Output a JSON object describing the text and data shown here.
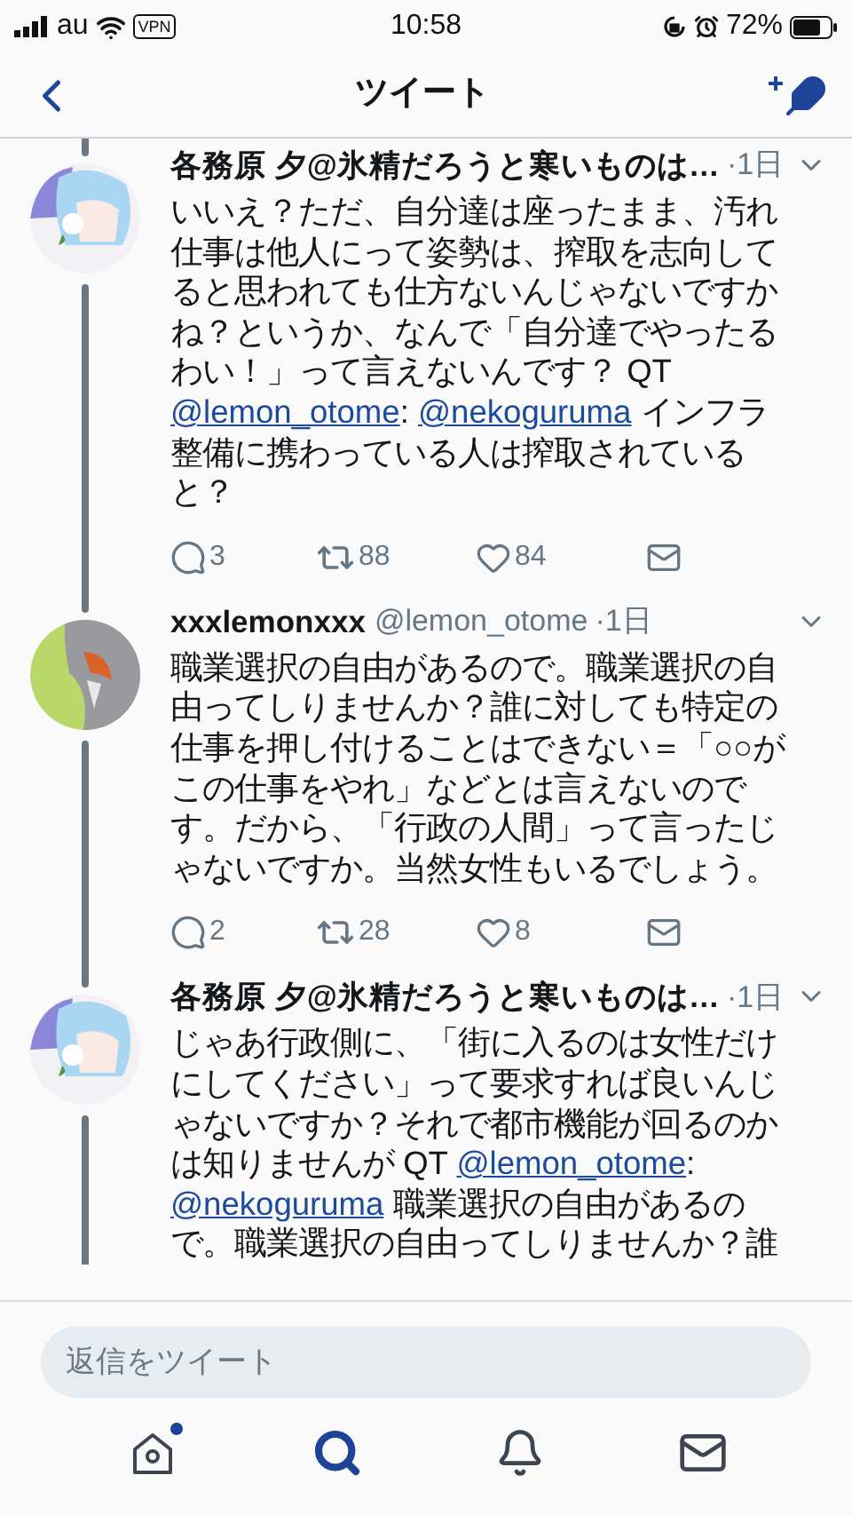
{
  "status_bar": {
    "carrier": "au",
    "vpn": "VPN",
    "time": "10:58",
    "battery": "72%"
  },
  "header": {
    "title": "ツイート"
  },
  "tweets": [
    {
      "name": "各務原 夕@氷精だろうと寒いものは…",
      "time": "·1日",
      "body": [
        {
          "kind": "text",
          "text": "いいえ？ただ、自分達は座ったまま、汚れ仕事は他人にって姿勢は、搾取を志向してると思われても仕方ないんじゃないですかね？というか、なんで「自分達でやったるわい！」って言えないんです？ QT "
        },
        {
          "kind": "mention",
          "text": "@lemon_otome"
        },
        {
          "kind": "text",
          "text": ": "
        },
        {
          "kind": "mention",
          "text": "@nekoguruma"
        },
        {
          "kind": "text",
          "text": " インフラ整備に携わっている人は搾取されていると？"
        }
      ],
      "replies": "3",
      "retweets": "88",
      "likes": "84"
    },
    {
      "name": "xxxlemonxxx",
      "handle": "@lemon_otome",
      "time": "·1日",
      "body": [
        {
          "kind": "text",
          "text": "職業選択の自由があるので。職業選択の自由ってしりませんか？誰に対しても特定の仕事を押し付けることはできない＝「○○がこの仕事をやれ」などとは言えないのです。だから、「行政の人間」って言ったじゃないですか。当然女性もいるでしょう。"
        }
      ],
      "replies": "2",
      "retweets": "28",
      "likes": "8"
    },
    {
      "name": "各務原 夕@氷精だろうと寒いものは…",
      "time": "·1日",
      "body": [
        {
          "kind": "text",
          "text": "じゃあ行政側に、「街に入るのは女性だけにしてください」って要求すれば良いんじゃないですか？それで都市機能が回るのかは知りませんが QT "
        },
        {
          "kind": "mention",
          "text": "@lemon_otome"
        },
        {
          "kind": "text",
          "text": ": "
        },
        {
          "kind": "mention",
          "text": "@nekoguruma"
        },
        {
          "kind": "text",
          "text": " 職業選択の自由があるので。職業選択の自由ってしりませんか？誰"
        }
      ]
    }
  ],
  "reply_field": {
    "placeholder": "返信をツイート"
  },
  "tab_bar": [
    {
      "kind": "home",
      "selected": false,
      "badge": true
    },
    {
      "kind": "search",
      "selected": true,
      "badge": false
    },
    {
      "kind": "bell",
      "selected": false,
      "badge": false
    },
    {
      "kind": "mail",
      "selected": false,
      "badge": false
    }
  ]
}
